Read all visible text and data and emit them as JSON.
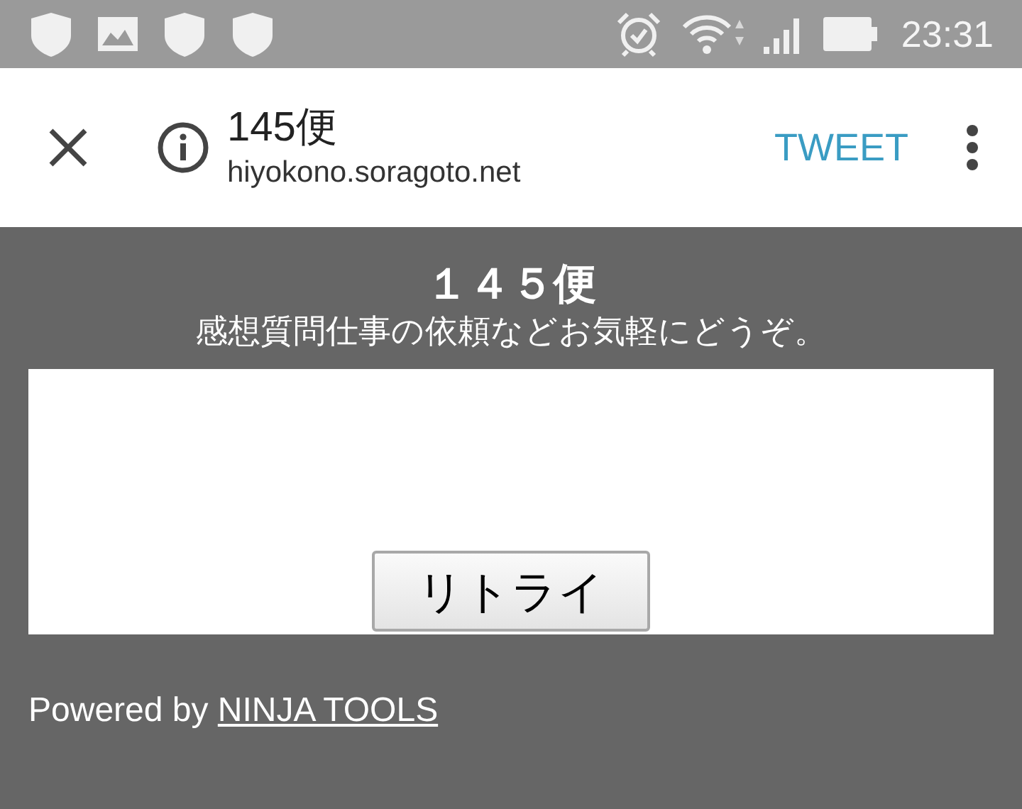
{
  "status_bar": {
    "time": "23:31"
  },
  "toolbar": {
    "title": "145便",
    "url": "hiyokono.soragoto.net",
    "action": "TWEET"
  },
  "page": {
    "heading": "１４５便",
    "subtitle": "感想質問仕事の依頼などお気軽にどうぞ。",
    "retry_button": "リトライ",
    "footer_text": "Powered by ",
    "footer_link": "NINJA TOOLS"
  }
}
